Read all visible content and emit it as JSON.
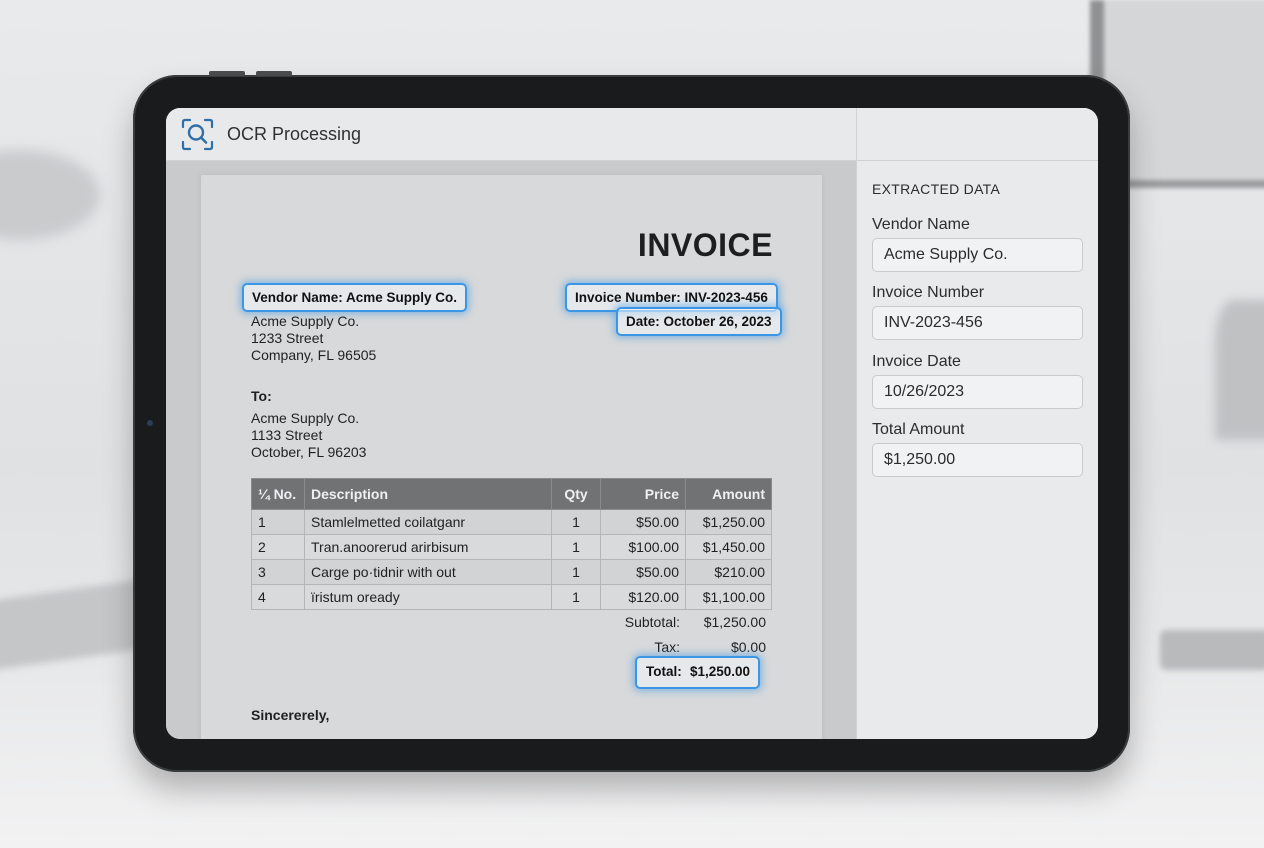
{
  "app": {
    "title": "OCR Processing",
    "icon": "scan-search-icon"
  },
  "invoice": {
    "title": "INVOICE",
    "highlights": {
      "vendor": "Vendor Name: Acme Supply Co.",
      "invoice_number": "Invoice Number: INV-2023-456",
      "date": "Date: October 26, 2023",
      "total_label": "Total:",
      "total_value": "$1,250.00"
    },
    "from": [
      "Acme Supply Co.",
      "1233 Street",
      "Company, FL 96505"
    ],
    "to_label": "To:",
    "to": [
      "Acme Supply Co.",
      "1133 Street",
      "October, FL 96203"
    ],
    "table": {
      "headers": [
        "¼ No.",
        "Description",
        "Qty",
        "Price",
        "Amount"
      ],
      "rows": [
        [
          "1",
          "Stamlelmetted coilatganr",
          "1",
          "$50.00",
          "$1,250.00"
        ],
        [
          "2",
          "Tran.anoorerud arirbisum",
          "1",
          "$100.00",
          "$1,450.00"
        ],
        [
          "3",
          "Carge po·tidnir with out",
          "1",
          "$50.00",
          "$210.00"
        ],
        [
          "4",
          "ïristum oready",
          "1",
          "$120.00",
          "$1,100.00"
        ]
      ]
    },
    "subtotal_label": "Subtotal:",
    "subtotal_value": "$1,250.00",
    "tax_label": "Tax:",
    "tax_value": "$0.00",
    "closing": "Sincererely,"
  },
  "panel": {
    "heading": "EXTRACTED DATA",
    "fields": [
      {
        "label": "Vendor Name",
        "value": "Acme Supply Co."
      },
      {
        "label": "Invoice Number",
        "value": "INV-2023-456"
      },
      {
        "label": "Invoice Date",
        "value": "10/26/2023"
      },
      {
        "label": "Total Amount",
        "value": "$1,250.00"
      }
    ]
  },
  "colors": {
    "highlight": "#3b97e6",
    "accent_icon": "#2f6fa8"
  }
}
